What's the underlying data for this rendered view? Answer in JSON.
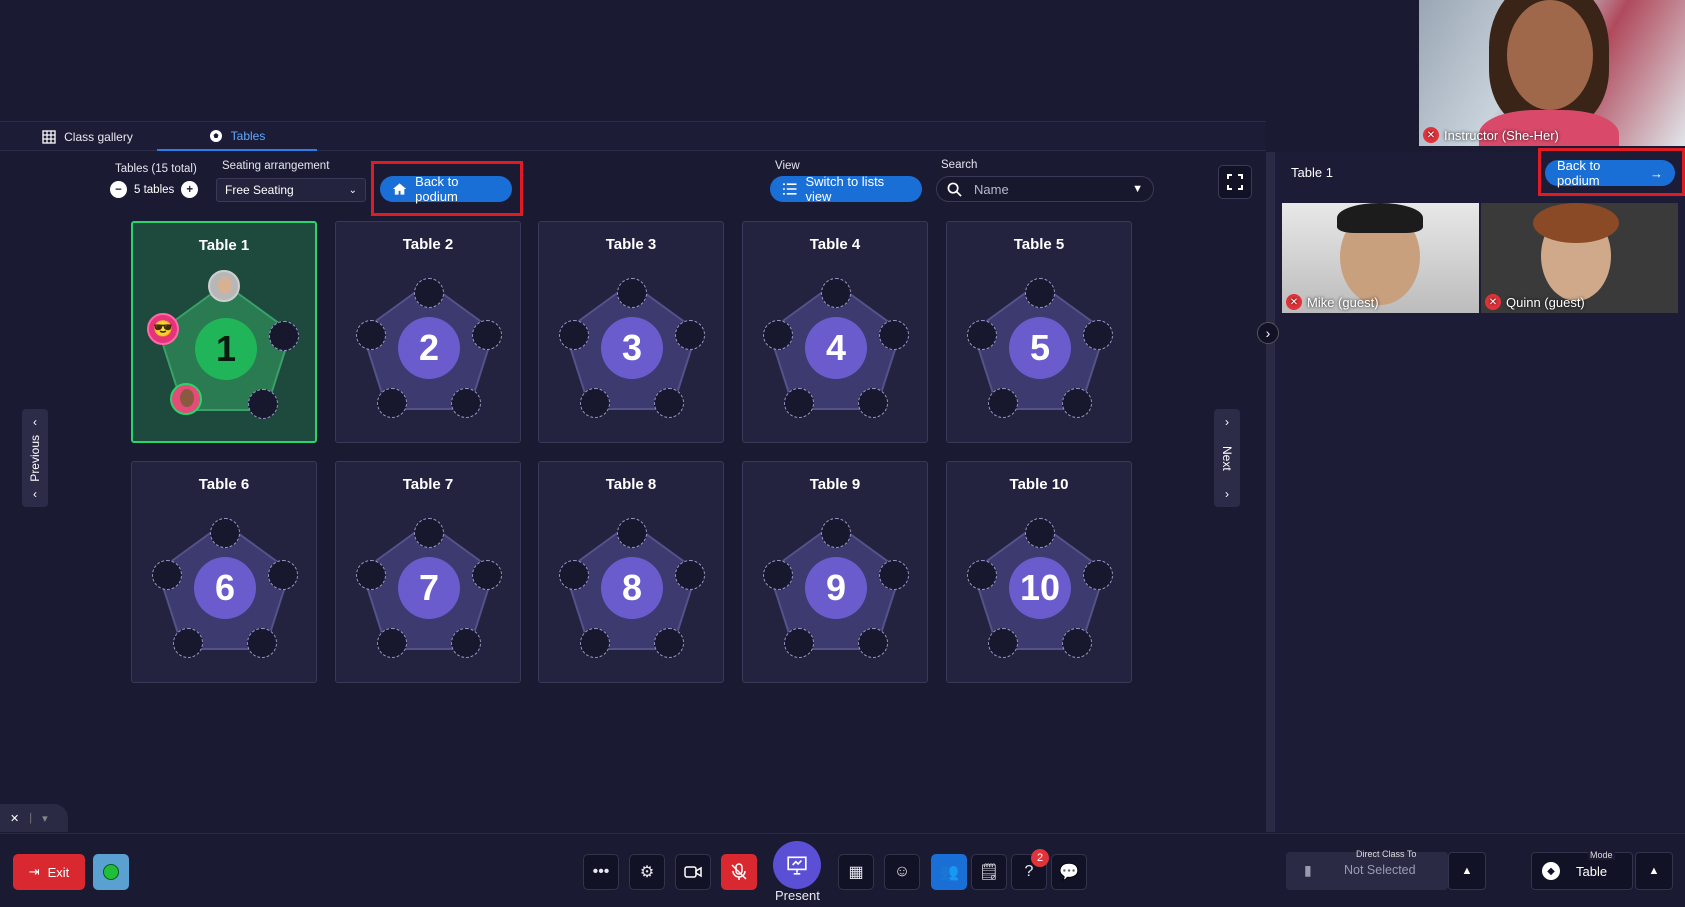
{
  "tabs": [
    {
      "label": "Class gallery",
      "icon": "grid-icon"
    },
    {
      "label": "Tables",
      "icon": "soccer-ball-icon"
    }
  ],
  "instructor": {
    "label": "Instructor (She-Her)"
  },
  "controls": {
    "tables_label": "Tables (15 total)",
    "tables_count": "5 tables",
    "seating_label": "Seating arrangement",
    "seating_value": "Free Seating",
    "back_to_podium": "Back to podium",
    "view_label": "View",
    "switch_view": "Switch to lists view",
    "search_label": "Search",
    "search_placeholder": "Name"
  },
  "tables": [
    {
      "title": "Table 1",
      "number": "1",
      "selected": true
    },
    {
      "title": "Table 2",
      "number": "2"
    },
    {
      "title": "Table 3",
      "number": "3"
    },
    {
      "title": "Table 4",
      "number": "4"
    },
    {
      "title": "Table 5",
      "number": "5"
    },
    {
      "title": "Table 6",
      "number": "6"
    },
    {
      "title": "Table 7",
      "number": "7"
    },
    {
      "title": "Table 8",
      "number": "8"
    },
    {
      "title": "Table 9",
      "number": "9"
    },
    {
      "title": "Table 10",
      "number": "10"
    }
  ],
  "nav": {
    "previous": "Previous",
    "next": "Next"
  },
  "right_panel": {
    "title": "Table 1",
    "back_to_podium": "Back to podium",
    "participants": [
      {
        "name": "Mike (guest)"
      },
      {
        "name": "Quinn (guest)"
      }
    ]
  },
  "toolbar": {
    "exit": "Exit",
    "present": "Present",
    "chat_badge": "2",
    "direct_class_label": "Direct Class To",
    "direct_class_value": "Not Selected",
    "mode_label": "Mode",
    "mode_value": "Table"
  },
  "colors": {
    "accent": "#1a6fd6",
    "selected": "#2bd46a",
    "table_num": "#6a5ccc",
    "danger": "#e0333a",
    "highlight": "#e01b24"
  }
}
